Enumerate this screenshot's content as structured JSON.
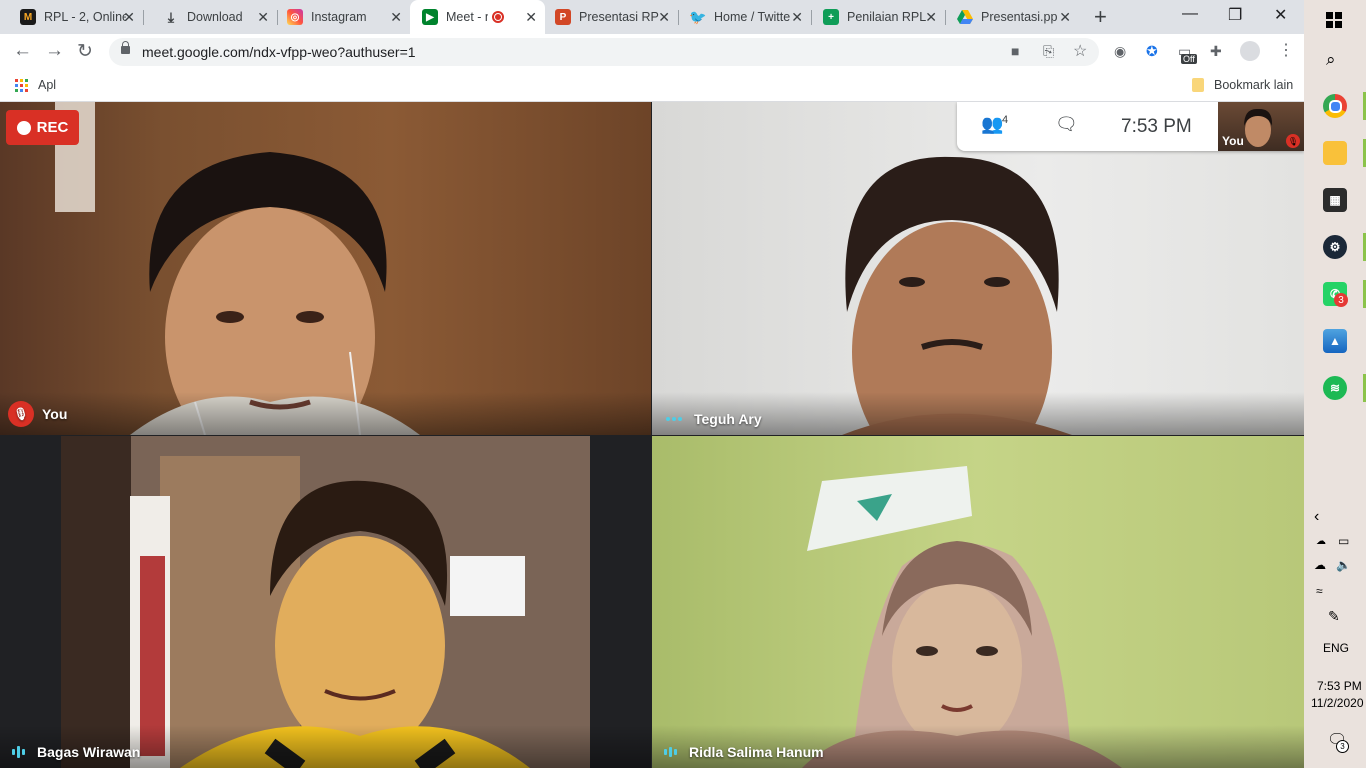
{
  "tabs": [
    {
      "title": "RPL - 2, Online",
      "icon": "moodle-icon"
    },
    {
      "title": "Download",
      "icon": "download-icon"
    },
    {
      "title": "Instagram",
      "icon": "instagram-icon"
    },
    {
      "title": "Meet - n",
      "icon": "meet-icon",
      "active": true
    },
    {
      "title": "Presentasi RP",
      "icon": "powerpoint-icon"
    },
    {
      "title": "Home / Twitte",
      "icon": "twitter-icon"
    },
    {
      "title": "Penilaian RPL",
      "icon": "sheets-icon"
    },
    {
      "title": "Presentasi.pp",
      "icon": "drive-icon"
    }
  ],
  "address_bar": {
    "url": "meet.google.com/ndx-vfpp-weo?authuser=1"
  },
  "extensions": {
    "off_badge": "Off"
  },
  "bookmarks": {
    "apps_label": "Apl",
    "other_label": "Bookmark lain"
  },
  "meet": {
    "rec_label": "REC",
    "participant_count": "4",
    "time": "7:53  PM",
    "self_view_label": "You",
    "participants": [
      {
        "name": "You",
        "muted": true
      },
      {
        "name": "Teguh Ary",
        "muted": false
      },
      {
        "name": "Bagas Wirawan",
        "muted": false
      },
      {
        "name": "Ridla Salima Hanum",
        "muted": false
      }
    ]
  },
  "taskbar": {
    "whatsapp_badge": "3",
    "language": "ENG",
    "clock_time": "7:53 PM",
    "clock_date": "11/2/2020",
    "notification_count": "3"
  }
}
